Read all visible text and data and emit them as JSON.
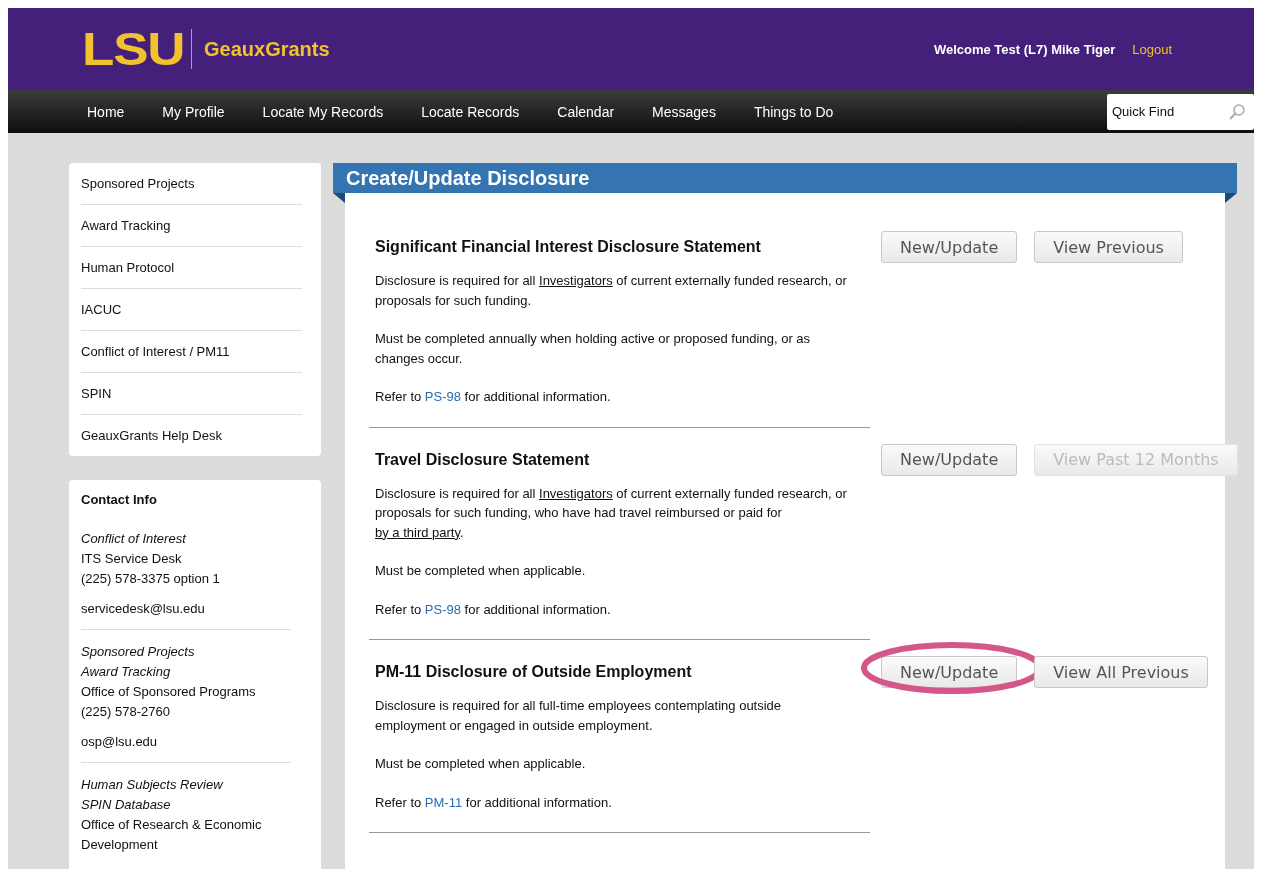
{
  "header": {
    "logo": "LSU",
    "app_name": "GeauxGrants",
    "welcome": "Welcome Test (L7) Mike Tiger",
    "logout": "Logout"
  },
  "nav": {
    "items": [
      "Home",
      "My Profile",
      "Locate My Records",
      "Locate Records",
      "Calendar",
      "Messages",
      "Things to Do"
    ],
    "search": {
      "placeholder": "Quick Find"
    }
  },
  "sidebar": {
    "items": [
      "Sponsored Projects",
      "Award Tracking",
      "Human Protocol",
      "IACUC",
      "Conflict of Interest / PM11",
      "SPIN",
      "GeauxGrants Help Desk"
    ]
  },
  "contact": {
    "title": "Contact Info",
    "groups": [
      {
        "lines": [
          {
            "text": "Conflict of Interest",
            "kind": "italic"
          },
          {
            "text": "ITS Service Desk",
            "kind": "plain"
          },
          {
            "text": "(225) 578-3375 option 1",
            "kind": "plain"
          }
        ],
        "email": "servicedesk@lsu.edu"
      },
      {
        "lines": [
          {
            "text": "Sponsored Projects",
            "kind": "italic"
          },
          {
            "text": "Award Tracking",
            "kind": "italic"
          },
          {
            "text": "Office of Sponsored Programs",
            "kind": "plain"
          },
          {
            "text": "(225) 578-2760",
            "kind": "plain"
          }
        ],
        "email": "osp@lsu.edu"
      },
      {
        "lines": [
          {
            "text": "Human Subjects Review",
            "kind": "italic"
          },
          {
            "text": "SPIN Database",
            "kind": "italic"
          },
          {
            "text": "Office of Research & Economic Development",
            "kind": "plain"
          }
        ]
      }
    ]
  },
  "main": {
    "title": "Create/Update Disclosure",
    "sections": [
      {
        "title": "Significant Financial Interest Disclosure Statement",
        "buttons": [
          {
            "label": "New/Update",
            "disabled": false,
            "highlighted": false
          },
          {
            "label": "View Previous",
            "disabled": false,
            "highlighted": false
          }
        ],
        "paragraphs": [
          [
            {
              "text": "Disclosure is required for all ",
              "kind": "text"
            },
            {
              "text": "Investigators",
              "kind": "underline"
            },
            {
              "text": " of current externally funded research, or proposals for such funding.",
              "kind": "text"
            }
          ],
          [
            {
              "text": "Must be completed annually when holding active or proposed funding, or as changes occur.",
              "kind": "text"
            }
          ],
          [
            {
              "text": "Refer to ",
              "kind": "text"
            },
            {
              "text": "PS-98",
              "kind": "link"
            },
            {
              "text": " for additional information.",
              "kind": "text"
            }
          ]
        ]
      },
      {
        "title": "Travel Disclosure Statement",
        "buttons": [
          {
            "label": "New/Update",
            "disabled": false,
            "highlighted": false
          },
          {
            "label": "View Past 12 Months",
            "disabled": true,
            "highlighted": false
          }
        ],
        "paragraphs": [
          [
            {
              "text": "Disclosure is required for all ",
              "kind": "text"
            },
            {
              "text": "Investigators",
              "kind": "underline"
            },
            {
              "text": " of current externally funded research, or proposals for such funding, who have had travel reimbursed or paid for ",
              "kind": "text"
            },
            {
              "text": "by a third party",
              "kind": "underline"
            },
            {
              "text": ".",
              "kind": "text"
            }
          ],
          [
            {
              "text": "Must be completed when applicable.",
              "kind": "text"
            }
          ],
          [
            {
              "text": "Refer to ",
              "kind": "text"
            },
            {
              "text": "PS-98",
              "kind": "link"
            },
            {
              "text": " for additional information.",
              "kind": "text"
            }
          ]
        ]
      },
      {
        "title": "PM-11 Disclosure of Outside Employment",
        "buttons": [
          {
            "label": "New/Update",
            "disabled": false,
            "highlighted": true
          },
          {
            "label": "View All Previous",
            "disabled": false,
            "highlighted": false
          }
        ],
        "paragraphs": [
          [
            {
              "text": "Disclosure is required for all full-time employees contemplating outside employment or engaged in outside employment.",
              "kind": "text"
            }
          ],
          [
            {
              "text": "Must be completed when applicable.",
              "kind": "text"
            }
          ],
          [
            {
              "text": "Refer to ",
              "kind": "text"
            },
            {
              "text": "PM-11",
              "kind": "link"
            },
            {
              "text": " for additional information.",
              "kind": "text"
            }
          ]
        ]
      }
    ]
  }
}
